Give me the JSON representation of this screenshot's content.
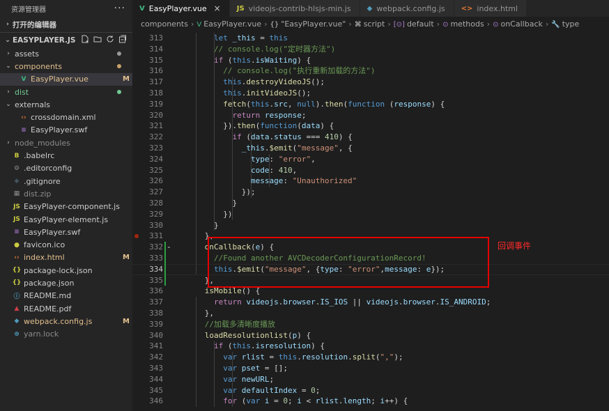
{
  "sidebar": {
    "title": "资源管理器",
    "more": "···",
    "open_editors": "打开的编辑器",
    "project": "EASYPLAYER.JS",
    "items": [
      {
        "name": "assets",
        "kind": "folder",
        "chev": "›",
        "depth": 0,
        "dot": "#9a9a9a",
        "style": "normal"
      },
      {
        "name": "components",
        "kind": "folder",
        "chev": "⌄",
        "depth": 0,
        "dot": "#c7a46a",
        "style": "modified"
      },
      {
        "name": "EasyPlayer.vue",
        "kind": "vue",
        "chev": "",
        "depth": 1,
        "badge": "M",
        "style": "modified",
        "selected": true
      },
      {
        "name": "dist",
        "kind": "folder",
        "chev": "›",
        "depth": 0,
        "dot": "#73c991",
        "style": "added"
      },
      {
        "name": "externals",
        "kind": "folder",
        "chev": "⌄",
        "depth": 0,
        "style": "normal"
      },
      {
        "name": "crossdomain.xml",
        "kind": "xml",
        "chev": "",
        "depth": 1,
        "style": "normal"
      },
      {
        "name": "EasyPlayer.swf",
        "kind": "swf",
        "chev": "",
        "depth": 1,
        "style": "normal"
      },
      {
        "name": "node_modules",
        "kind": "folder",
        "chev": "›",
        "depth": 0,
        "style": "dim"
      },
      {
        "name": ".babelrc",
        "kind": "babel",
        "chev": "",
        "depth": 0,
        "style": "normal"
      },
      {
        "name": ".editorconfig",
        "kind": "gear",
        "chev": "",
        "depth": 0,
        "style": "normal"
      },
      {
        "name": ".gitignore",
        "kind": "git",
        "chev": "",
        "depth": 0,
        "style": "normal"
      },
      {
        "name": "dist.zip",
        "kind": "zip",
        "chev": "",
        "depth": 0,
        "style": "dim"
      },
      {
        "name": "EasyPlayer-component.js",
        "kind": "js",
        "chev": "",
        "depth": 0,
        "style": "normal"
      },
      {
        "name": "EasyPlayer-element.js",
        "kind": "js",
        "chev": "",
        "depth": 0,
        "style": "normal"
      },
      {
        "name": "EasyPlayer.swf",
        "kind": "swf",
        "chev": "",
        "depth": 0,
        "style": "normal"
      },
      {
        "name": "favicon.ico",
        "kind": "ico",
        "chev": "",
        "depth": 0,
        "style": "normal"
      },
      {
        "name": "index.html",
        "kind": "html",
        "chev": "",
        "depth": 0,
        "badge": "M",
        "style": "modified"
      },
      {
        "name": "package-lock.json",
        "kind": "json",
        "chev": "",
        "depth": 0,
        "style": "normal"
      },
      {
        "name": "package.json",
        "kind": "json",
        "chev": "",
        "depth": 0,
        "style": "normal"
      },
      {
        "name": "README.md",
        "kind": "info",
        "chev": "",
        "depth": 0,
        "style": "normal"
      },
      {
        "name": "README.pdf",
        "kind": "pdf",
        "chev": "",
        "depth": 0,
        "style": "normal"
      },
      {
        "name": "webpack.config.js",
        "kind": "webpack",
        "chev": "",
        "depth": 0,
        "badge": "M",
        "style": "modified"
      },
      {
        "name": "yarn.lock",
        "kind": "yarn",
        "chev": "",
        "depth": 0,
        "style": "dim"
      }
    ]
  },
  "tabs": [
    {
      "label": "EasyPlayer.vue",
      "icon": "V",
      "icon_color": "#41b883",
      "active": true,
      "close": "×"
    },
    {
      "label": "videojs-contrib-hlsjs-min.js",
      "icon": "JS",
      "icon_color": "#cbcb41",
      "active": false
    },
    {
      "label": "webpack.config.js",
      "icon": "◆",
      "icon_color": "#519aba",
      "active": false
    },
    {
      "label": "index.html",
      "icon": "<>",
      "icon_color": "#e37933",
      "active": false
    }
  ],
  "breadcrumb": [
    {
      "label": "components",
      "icon": ""
    },
    {
      "label": "EasyPlayer.vue",
      "icon": "V"
    },
    {
      "label": "\"EasyPlayer.vue\"",
      "icon": "{}"
    },
    {
      "label": "script",
      "icon": "⌘"
    },
    {
      "label": "default",
      "icon": "[⊙]"
    },
    {
      "label": "methods",
      "icon": "⊙"
    },
    {
      "label": "onCallback",
      "icon": "⊙"
    },
    {
      "label": "type",
      "icon": "🔧"
    }
  ],
  "editor": {
    "current_line": 334,
    "lines": [
      {
        "n": 313,
        "toks": [
          [
            "        ",
            "id"
          ],
          [
            "let",
            "kw"
          ],
          [
            " _this ",
            "var"
          ],
          [
            "=",
            "id"
          ],
          [
            " this",
            "kw"
          ]
        ]
      },
      {
        "n": 314,
        "toks": [
          [
            "        ",
            "id"
          ],
          [
            "// console.log(\"定时器方法\")",
            "cmt"
          ]
        ]
      },
      {
        "n": 315,
        "toks": [
          [
            "        ",
            "id"
          ],
          [
            "if",
            "ctl"
          ],
          [
            " (",
            "id"
          ],
          [
            "this",
            "kw"
          ],
          [
            ".",
            "id"
          ],
          [
            "isWaiting",
            "prop"
          ],
          [
            ") {",
            "id"
          ]
        ]
      },
      {
        "n": 316,
        "toks": [
          [
            "          ",
            "id"
          ],
          [
            "// console.log(\"执行重新加载的方法\")",
            "cmt"
          ]
        ]
      },
      {
        "n": 317,
        "toks": [
          [
            "          ",
            "id"
          ],
          [
            "this",
            "kw"
          ],
          [
            ".",
            "id"
          ],
          [
            "destroyVideoJS",
            "fn"
          ],
          [
            "();",
            "id"
          ]
        ]
      },
      {
        "n": 318,
        "toks": [
          [
            "          ",
            "id"
          ],
          [
            "this",
            "kw"
          ],
          [
            ".",
            "id"
          ],
          [
            "initVideoJS",
            "fn"
          ],
          [
            "();",
            "id"
          ]
        ]
      },
      {
        "n": 319,
        "toks": [
          [
            "          ",
            "id"
          ],
          [
            "fetch",
            "fn"
          ],
          [
            "(",
            "id"
          ],
          [
            "this",
            "kw"
          ],
          [
            ".",
            "id"
          ],
          [
            "src",
            "prop"
          ],
          [
            ", ",
            "id"
          ],
          [
            "null",
            "kw"
          ],
          [
            ").",
            "id"
          ],
          [
            "then",
            "fn"
          ],
          [
            "(",
            "id"
          ],
          [
            "function",
            "kw"
          ],
          [
            " (",
            "id"
          ],
          [
            "response",
            "var"
          ],
          [
            ") {",
            "id"
          ]
        ]
      },
      {
        "n": 320,
        "toks": [
          [
            "            ",
            "id"
          ],
          [
            "return",
            "ctl"
          ],
          [
            " response",
            "var"
          ],
          [
            ";",
            "id"
          ]
        ]
      },
      {
        "n": 321,
        "toks": [
          [
            "          ",
            "id"
          ],
          [
            "}).",
            "id"
          ],
          [
            "then",
            "fn"
          ],
          [
            "(",
            "id"
          ],
          [
            "function",
            "kw"
          ],
          [
            "(",
            "id"
          ],
          [
            "data",
            "var"
          ],
          [
            ") {",
            "id"
          ]
        ]
      },
      {
        "n": 322,
        "toks": [
          [
            "            ",
            "id"
          ],
          [
            "if",
            "ctl"
          ],
          [
            " (",
            "id"
          ],
          [
            "data",
            "var"
          ],
          [
            ".",
            "id"
          ],
          [
            "status",
            "prop"
          ],
          [
            " === ",
            "id"
          ],
          [
            "410",
            "num"
          ],
          [
            ") {",
            "id"
          ]
        ]
      },
      {
        "n": 323,
        "toks": [
          [
            "              ",
            "id"
          ],
          [
            "_this",
            "var"
          ],
          [
            ".",
            "id"
          ],
          [
            "$emit",
            "fn"
          ],
          [
            "(",
            "id"
          ],
          [
            "\"message\"",
            "str"
          ],
          [
            ", {",
            "id"
          ]
        ]
      },
      {
        "n": 324,
        "toks": [
          [
            "                ",
            "id"
          ],
          [
            "type",
            "prop"
          ],
          [
            ": ",
            "id"
          ],
          [
            "\"error\"",
            "str"
          ],
          [
            ",",
            "id"
          ]
        ]
      },
      {
        "n": 325,
        "toks": [
          [
            "                ",
            "id"
          ],
          [
            "code",
            "prop"
          ],
          [
            ": ",
            "id"
          ],
          [
            "410",
            "num"
          ],
          [
            ",",
            "id"
          ]
        ]
      },
      {
        "n": 326,
        "toks": [
          [
            "                ",
            "id"
          ],
          [
            "message",
            "prop"
          ],
          [
            ": ",
            "id"
          ],
          [
            "\"Unauthorized\"",
            "str"
          ]
        ]
      },
      {
        "n": 327,
        "toks": [
          [
            "              ",
            "id"
          ],
          [
            "});",
            "id"
          ]
        ]
      },
      {
        "n": 328,
        "toks": [
          [
            "            ",
            "id"
          ],
          [
            "}",
            "id"
          ]
        ]
      },
      {
        "n": 329,
        "toks": [
          [
            "          ",
            "id"
          ],
          [
            "})",
            "id"
          ]
        ]
      },
      {
        "n": 330,
        "toks": [
          [
            "        ",
            "id"
          ],
          [
            "}",
            "id"
          ]
        ]
      },
      {
        "n": 331,
        "toks": [
          [
            "      ",
            "id"
          ],
          [
            "},",
            "id"
          ]
        ]
      },
      {
        "n": 332,
        "toks": [
          [
            "      ",
            "id"
          ],
          [
            "onCallback",
            "fn"
          ],
          [
            "(",
            "id"
          ],
          [
            "e",
            "var"
          ],
          [
            ") {",
            "id"
          ]
        ]
      },
      {
        "n": 333,
        "toks": [
          [
            "        ",
            "id"
          ],
          [
            "//Found another AVCDecoderConfigurationRecord!",
            "cmt"
          ]
        ]
      },
      {
        "n": 334,
        "toks": [
          [
            "        ",
            "id"
          ],
          [
            "this",
            "kw"
          ],
          [
            ".",
            "id"
          ],
          [
            "$emit",
            "fn"
          ],
          [
            "(",
            "id"
          ],
          [
            "\"message\"",
            "str"
          ],
          [
            ", {",
            "id"
          ],
          [
            "type",
            "prop"
          ],
          [
            ": ",
            "id"
          ],
          [
            "\"error\"",
            "str"
          ],
          [
            ",",
            "id"
          ],
          [
            "message",
            "prop"
          ],
          [
            ": ",
            "id"
          ],
          [
            "e",
            "var"
          ],
          [
            "});",
            "id"
          ]
        ]
      },
      {
        "n": 335,
        "toks": [
          [
            "      ",
            "id"
          ],
          [
            "},",
            "id"
          ]
        ]
      },
      {
        "n": 336,
        "toks": [
          [
            "      ",
            "id"
          ],
          [
            "isMobile",
            "fn"
          ],
          [
            "() {",
            "id"
          ]
        ]
      },
      {
        "n": 337,
        "toks": [
          [
            "        ",
            "id"
          ],
          [
            "return",
            "ctl"
          ],
          [
            " videojs",
            "var"
          ],
          [
            ".",
            "id"
          ],
          [
            "browser",
            "prop"
          ],
          [
            ".",
            "id"
          ],
          [
            "IS_IOS",
            "prop"
          ],
          [
            " || ",
            "id"
          ],
          [
            "videojs",
            "var"
          ],
          [
            ".",
            "id"
          ],
          [
            "browser",
            "prop"
          ],
          [
            ".",
            "id"
          ],
          [
            "IS_ANDROID",
            "prop"
          ],
          [
            ";",
            "id"
          ]
        ]
      },
      {
        "n": 338,
        "toks": [
          [
            "      ",
            "id"
          ],
          [
            "},",
            "id"
          ]
        ]
      },
      {
        "n": 339,
        "toks": [
          [
            "      ",
            "id"
          ],
          [
            "//加载多清晰度播放",
            "cmt"
          ]
        ]
      },
      {
        "n": 340,
        "toks": [
          [
            "      ",
            "id"
          ],
          [
            "loadResolutionlist",
            "fn"
          ],
          [
            "(",
            "id"
          ],
          [
            "p",
            "var"
          ],
          [
            ") {",
            "id"
          ]
        ]
      },
      {
        "n": 341,
        "toks": [
          [
            "        ",
            "id"
          ],
          [
            "if",
            "ctl"
          ],
          [
            " (",
            "id"
          ],
          [
            "this",
            "kw"
          ],
          [
            ".",
            "id"
          ],
          [
            "isresolution",
            "prop"
          ],
          [
            ") {",
            "id"
          ]
        ]
      },
      {
        "n": 342,
        "toks": [
          [
            "          ",
            "id"
          ],
          [
            "var",
            "kw"
          ],
          [
            " rlist ",
            "var"
          ],
          [
            "= ",
            "id"
          ],
          [
            "this",
            "kw"
          ],
          [
            ".",
            "id"
          ],
          [
            "resolution",
            "prop"
          ],
          [
            ".",
            "id"
          ],
          [
            "split",
            "fn"
          ],
          [
            "(",
            "id"
          ],
          [
            "\",\"",
            "str"
          ],
          [
            ");",
            "id"
          ]
        ]
      },
      {
        "n": 343,
        "toks": [
          [
            "          ",
            "id"
          ],
          [
            "var",
            "kw"
          ],
          [
            " pset ",
            "var"
          ],
          [
            "= [];",
            "id"
          ]
        ]
      },
      {
        "n": 344,
        "toks": [
          [
            "          ",
            "id"
          ],
          [
            "var",
            "kw"
          ],
          [
            " newURL",
            "var"
          ],
          [
            ";",
            "id"
          ]
        ]
      },
      {
        "n": 345,
        "toks": [
          [
            "          ",
            "id"
          ],
          [
            "var",
            "kw"
          ],
          [
            " defaultIndex ",
            "var"
          ],
          [
            "= ",
            "id"
          ],
          [
            "0",
            "num"
          ],
          [
            ";",
            "id"
          ]
        ]
      },
      {
        "n": 346,
        "toks": [
          [
            "          ",
            "id"
          ],
          [
            "for",
            "ctl"
          ],
          [
            " (",
            "id"
          ],
          [
            "var",
            "kw"
          ],
          [
            " i ",
            "var"
          ],
          [
            "= ",
            "id"
          ],
          [
            "0",
            "num"
          ],
          [
            "; ",
            "id"
          ],
          [
            "i",
            "var"
          ],
          [
            " < ",
            "id"
          ],
          [
            "rlist",
            "var"
          ],
          [
            ".",
            "id"
          ],
          [
            "length",
            "prop"
          ],
          [
            "; ",
            "id"
          ],
          [
            "i",
            "var"
          ],
          [
            "++) {",
            "id"
          ]
        ]
      }
    ]
  },
  "annotation": {
    "label": "回调事件",
    "color": "#e60000"
  }
}
